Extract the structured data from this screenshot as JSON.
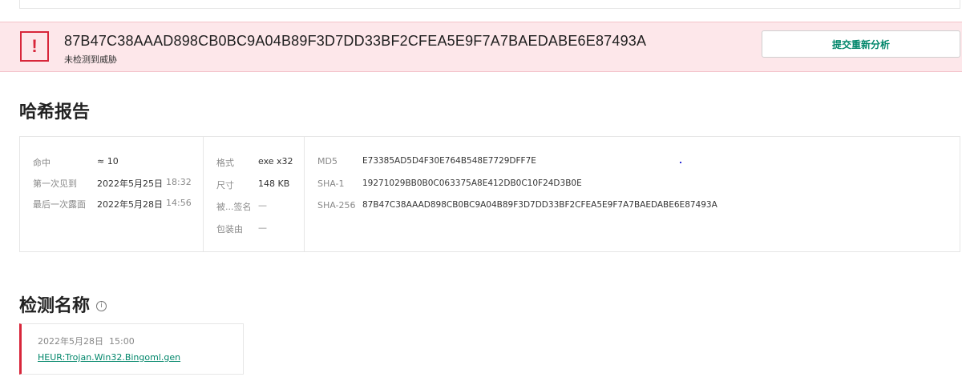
{
  "alert": {
    "hash": "87B47C38AAAD898CB0BC9A04B89F3D7DD33BF2CFEA5E9F7A7BAEDABE6E87493A",
    "status": "未检测到威胁",
    "icon_glyph": "!",
    "resubmit_label": "提交重新分析"
  },
  "hash_report": {
    "title": "哈希报告",
    "hits": {
      "label": "命中",
      "value": "≈ 10"
    },
    "first_seen": {
      "label": "第一次见到",
      "date": "2022年5月25日",
      "time": "18:32"
    },
    "last_seen": {
      "label": "最后一次露面",
      "date": "2022年5月28日",
      "time": "14:56"
    },
    "format": {
      "label": "格式",
      "value": "exe x32"
    },
    "size": {
      "label": "尺寸",
      "value": "148 KB"
    },
    "signed_by": {
      "label": "被...签名",
      "value": "—"
    },
    "packed_by": {
      "label": "包装由",
      "value": "—"
    },
    "md5": {
      "label": "MD5",
      "value": "E73385AD5D4F30E764B548E7729DFF7E"
    },
    "sha1": {
      "label": "SHA-1",
      "value": "19271029BB0B0C063375A8E412DB0C10F24D3B0E"
    },
    "sha256": {
      "label": "SHA-256",
      "value": "87B47C38AAAD898CB0BC9A04B89F3D7DD33BF2CFEA5E9F7A7BAEDABE6E87493A"
    }
  },
  "detection": {
    "title": "检测名称",
    "info_glyph": "i",
    "date": "2022年5月28日",
    "time": "15:00",
    "name": "HEUR:Trojan.Win32.Bingoml.gen"
  },
  "colors": {
    "danger": "#d8263a",
    "accent": "#00866a",
    "banner_bg": "#fde7ea"
  }
}
